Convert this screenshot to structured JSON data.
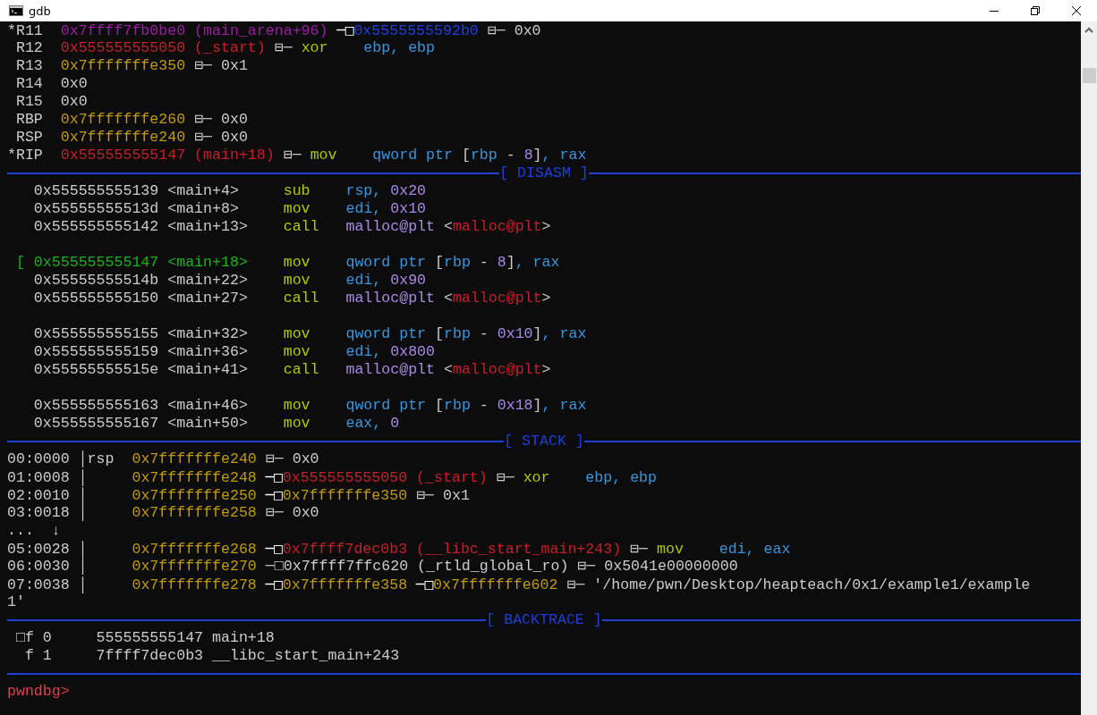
{
  "window": {
    "title": "gdb"
  },
  "terminal": {
    "lines": [
      {
        "kind": "text",
        "segments": [
          {
            "text": "*R11  ",
            "color": "#cccccc"
          },
          {
            "text": "0x7ffff7fb0be0 (main_arena+96)",
            "color": "#9b1fa0"
          },
          {
            "text": " ─□"
          },
          {
            "text": "0x5555555592b0",
            "color": "#1e40e0"
          },
          {
            "text": " ⊟─ 0x0",
            "color": "#cccccc"
          }
        ]
      },
      {
        "kind": "text",
        "segments": [
          {
            "text": " R12  ",
            "color": "#cccccc"
          },
          {
            "text": "0x555555555050 (_start)",
            "color": "#c8202a"
          },
          {
            "text": " ⊟─ ",
            "color": "#cccccc"
          },
          {
            "text": "xor",
            "color": "#b4c800"
          },
          {
            "text": "    ebp, ebp",
            "color": "#3a96dd"
          }
        ]
      },
      {
        "kind": "text",
        "segments": [
          {
            "text": " R13  ",
            "color": "#cccccc"
          },
          {
            "text": "0x7fffffffe350",
            "color": "#c19c00"
          },
          {
            "text": " ⊟─ 0x1",
            "color": "#cccccc"
          }
        ]
      },
      {
        "kind": "text",
        "segments": [
          {
            "text": " R14  0x0",
            "color": "#cccccc"
          }
        ]
      },
      {
        "kind": "text",
        "segments": [
          {
            "text": " R15  0x0",
            "color": "#cccccc"
          }
        ]
      },
      {
        "kind": "text",
        "segments": [
          {
            "text": " RBP  ",
            "color": "#cccccc"
          },
          {
            "text": "0x7fffffffe260",
            "color": "#c19c00"
          },
          {
            "text": " ⊟─ 0x0",
            "color": "#cccccc"
          }
        ]
      },
      {
        "kind": "text",
        "segments": [
          {
            "text": " RSP  ",
            "color": "#cccccc"
          },
          {
            "text": "0x7fffffffe240",
            "color": "#c19c00"
          },
          {
            "text": " ⊟─ 0x0",
            "color": "#cccccc"
          }
        ]
      },
      {
        "kind": "text",
        "segments": [
          {
            "text": "*RIP  ",
            "color": "#cccccc"
          },
          {
            "text": "0x555555555147 (main+18)",
            "color": "#c8202a"
          },
          {
            "text": " ⊟─ ",
            "color": "#cccccc"
          },
          {
            "text": "mov",
            "color": "#b4c800"
          },
          {
            "text": "    qword ptr ",
            "color": "#3a96dd"
          },
          {
            "text": "[",
            "color": "#cccccc"
          },
          {
            "text": "rbp",
            "color": "#3a96dd"
          },
          {
            "text": " - ",
            "color": "#cccccc"
          },
          {
            "text": "8",
            "color": "#a98ae8"
          },
          {
            "text": "]",
            "color": "#cccccc"
          },
          {
            "text": ", rax",
            "color": "#3a96dd"
          }
        ]
      },
      {
        "kind": "rule",
        "title": "[ DISASM ]"
      },
      {
        "kind": "text",
        "segments": [
          {
            "text": "   0x555555555139 <main+4>     ",
            "color": "#cccccc"
          },
          {
            "text": "sub    ",
            "color": "#b4c800"
          },
          {
            "text": "rsp, ",
            "color": "#3a96dd"
          },
          {
            "text": "0x20",
            "color": "#a98ae8"
          }
        ]
      },
      {
        "kind": "text",
        "segments": [
          {
            "text": "   0x55555555513d <main+8>     ",
            "color": "#cccccc"
          },
          {
            "text": "mov    ",
            "color": "#b4c800"
          },
          {
            "text": "edi, ",
            "color": "#3a96dd"
          },
          {
            "text": "0x10",
            "color": "#a98ae8"
          }
        ]
      },
      {
        "kind": "text",
        "segments": [
          {
            "text": "   0x555555555142 <main+13>    ",
            "color": "#cccccc"
          },
          {
            "text": "call   ",
            "color": "#b4c800"
          },
          {
            "text": "malloc@plt ",
            "color": "#a98ae8"
          },
          {
            "text": "<",
            "color": "#cccccc"
          },
          {
            "text": "malloc@plt",
            "color": "#c8202a"
          },
          {
            "text": ">",
            "color": "#cccccc"
          }
        ]
      },
      {
        "kind": "blank"
      },
      {
        "kind": "text",
        "segments": [
          {
            "text": " [ 0x555555555147 <main+18>    ",
            "color": "#1bb31b"
          },
          {
            "text": "mov    ",
            "color": "#b4c800"
          },
          {
            "text": "qword ptr ",
            "color": "#3a96dd"
          },
          {
            "text": "[",
            "color": "#cccccc"
          },
          {
            "text": "rbp",
            "color": "#3a96dd"
          },
          {
            "text": " - ",
            "color": "#cccccc"
          },
          {
            "text": "8",
            "color": "#a98ae8"
          },
          {
            "text": "]",
            "color": "#cccccc"
          },
          {
            "text": ", rax",
            "color": "#3a96dd"
          }
        ]
      },
      {
        "kind": "text",
        "segments": [
          {
            "text": "   0x55555555514b <main+22>    ",
            "color": "#cccccc"
          },
          {
            "text": "mov    ",
            "color": "#b4c800"
          },
          {
            "text": "edi, ",
            "color": "#3a96dd"
          },
          {
            "text": "0x90",
            "color": "#a98ae8"
          }
        ]
      },
      {
        "kind": "text",
        "segments": [
          {
            "text": "   0x555555555150 <main+27>    ",
            "color": "#cccccc"
          },
          {
            "text": "call   ",
            "color": "#b4c800"
          },
          {
            "text": "malloc@plt ",
            "color": "#a98ae8"
          },
          {
            "text": "<",
            "color": "#cccccc"
          },
          {
            "text": "malloc@plt",
            "color": "#c8202a"
          },
          {
            "text": ">",
            "color": "#cccccc"
          }
        ]
      },
      {
        "kind": "blank"
      },
      {
        "kind": "text",
        "segments": [
          {
            "text": "   0x555555555155 <main+32>    ",
            "color": "#cccccc"
          },
          {
            "text": "mov    ",
            "color": "#b4c800"
          },
          {
            "text": "qword ptr ",
            "color": "#3a96dd"
          },
          {
            "text": "[",
            "color": "#cccccc"
          },
          {
            "text": "rbp",
            "color": "#3a96dd"
          },
          {
            "text": " - ",
            "color": "#cccccc"
          },
          {
            "text": "0x10",
            "color": "#a98ae8"
          },
          {
            "text": "]",
            "color": "#cccccc"
          },
          {
            "text": ", rax",
            "color": "#3a96dd"
          }
        ]
      },
      {
        "kind": "text",
        "segments": [
          {
            "text": "   0x555555555159 <main+36>    ",
            "color": "#cccccc"
          },
          {
            "text": "mov    ",
            "color": "#b4c800"
          },
          {
            "text": "edi, ",
            "color": "#3a96dd"
          },
          {
            "text": "0x800",
            "color": "#a98ae8"
          }
        ]
      },
      {
        "kind": "text",
        "segments": [
          {
            "text": "   0x55555555515e <main+41>    ",
            "color": "#cccccc"
          },
          {
            "text": "call   ",
            "color": "#b4c800"
          },
          {
            "text": "malloc@plt ",
            "color": "#a98ae8"
          },
          {
            "text": "<",
            "color": "#cccccc"
          },
          {
            "text": "malloc@plt",
            "color": "#c8202a"
          },
          {
            "text": ">",
            "color": "#cccccc"
          }
        ]
      },
      {
        "kind": "blank"
      },
      {
        "kind": "text",
        "segments": [
          {
            "text": "   0x555555555163 <main+46>    ",
            "color": "#cccccc"
          },
          {
            "text": "mov    ",
            "color": "#b4c800"
          },
          {
            "text": "qword ptr ",
            "color": "#3a96dd"
          },
          {
            "text": "[",
            "color": "#cccccc"
          },
          {
            "text": "rbp",
            "color": "#3a96dd"
          },
          {
            "text": " - ",
            "color": "#cccccc"
          },
          {
            "text": "0x18",
            "color": "#a98ae8"
          },
          {
            "text": "]",
            "color": "#cccccc"
          },
          {
            "text": ", rax",
            "color": "#3a96dd"
          }
        ]
      },
      {
        "kind": "text",
        "segments": [
          {
            "text": "   0x555555555167 <main+50>    ",
            "color": "#cccccc"
          },
          {
            "text": "mov    ",
            "color": "#b4c800"
          },
          {
            "text": "eax, ",
            "color": "#3a96dd"
          },
          {
            "text": "0",
            "color": "#a98ae8"
          }
        ]
      },
      {
        "kind": "rule",
        "title": "[ STACK ]"
      },
      {
        "kind": "text",
        "segments": [
          {
            "text": "00:0000 │rsp  ",
            "color": "#cccccc"
          },
          {
            "text": "0x7fffffffe240",
            "color": "#c19c00"
          },
          {
            "text": " ⊟─ 0x0",
            "color": "#cccccc"
          }
        ]
      },
      {
        "kind": "text",
        "segments": [
          {
            "text": "01:0008 │     ",
            "color": "#cccccc"
          },
          {
            "text": "0x7fffffffe248",
            "color": "#c19c00"
          },
          {
            "text": " ─□"
          },
          {
            "text": "0x555555555050 (_start)",
            "color": "#c8202a"
          },
          {
            "text": " ⊟─ ",
            "color": "#cccccc"
          },
          {
            "text": "xor",
            "color": "#b4c800"
          },
          {
            "text": "    ebp, ebp",
            "color": "#3a96dd"
          }
        ]
      },
      {
        "kind": "text",
        "segments": [
          {
            "text": "02:0010 │     ",
            "color": "#cccccc"
          },
          {
            "text": "0x7fffffffe250",
            "color": "#c19c00"
          },
          {
            "text": " ─□"
          },
          {
            "text": "0x7fffffffe350",
            "color": "#c19c00"
          },
          {
            "text": " ⊟─ 0x1",
            "color": "#cccccc"
          }
        ]
      },
      {
        "kind": "text",
        "segments": [
          {
            "text": "03:0018 │     ",
            "color": "#cccccc"
          },
          {
            "text": "0x7fffffffe258",
            "color": "#c19c00"
          },
          {
            "text": " ⊟─ 0x0",
            "color": "#cccccc"
          }
        ]
      },
      {
        "kind": "text",
        "segments": [
          {
            "text": "...  ↓",
            "color": "#cccccc"
          }
        ]
      },
      {
        "kind": "text",
        "segments": [
          {
            "text": "05:0028 │     ",
            "color": "#cccccc"
          },
          {
            "text": "0x7fffffffe268",
            "color": "#c19c00"
          },
          {
            "text": " ─□"
          },
          {
            "text": "0x7ffff7dec0b3 (__libc_start_main+243)",
            "color": "#c8202a"
          },
          {
            "text": " ⊟─ ",
            "color": "#cccccc"
          },
          {
            "text": "mov",
            "color": "#b4c800"
          },
          {
            "text": "    edi, eax",
            "color": "#3a96dd"
          }
        ]
      },
      {
        "kind": "text",
        "segments": [
          {
            "text": "06:0030 │     ",
            "color": "#cccccc"
          },
          {
            "text": "0x7fffffffe270",
            "color": "#c19c00"
          },
          {
            "text": " ─□0x7ffff7ffc620 (_rtld_global_ro) ⊟─ 0x5041e00000000",
            "color": "#cccccc"
          }
        ]
      },
      {
        "kind": "text",
        "segments": [
          {
            "text": "07:0038 │     ",
            "color": "#cccccc"
          },
          {
            "text": "0x7fffffffe278",
            "color": "#c19c00"
          },
          {
            "text": " ─□"
          },
          {
            "text": "0x7fffffffe358",
            "color": "#c19c00"
          },
          {
            "text": " ─□"
          },
          {
            "text": "0x7fffffffe602",
            "color": "#c19c00"
          },
          {
            "text": " ⊟─ '/home/pwn/Desktop/heapteach/0x1/example1/example",
            "color": "#cccccc"
          }
        ]
      },
      {
        "kind": "text",
        "segments": [
          {
            "text": "1'",
            "color": "#cccccc"
          }
        ]
      },
      {
        "kind": "rule",
        "title": "[ BACKTRACE ]"
      },
      {
        "kind": "text",
        "segments": [
          {
            "text": " □f 0     555555555147 main+18",
            "color": "#cccccc"
          }
        ]
      },
      {
        "kind": "text",
        "segments": [
          {
            "text": "  f 1     7ffff7dec0b3 __libc_start_main+243",
            "color": "#cccccc"
          }
        ]
      },
      {
        "kind": "rule"
      },
      {
        "kind": "text",
        "segments": [
          {
            "text": "pwndbg>",
            "color": "#e04050"
          }
        ]
      }
    ]
  }
}
